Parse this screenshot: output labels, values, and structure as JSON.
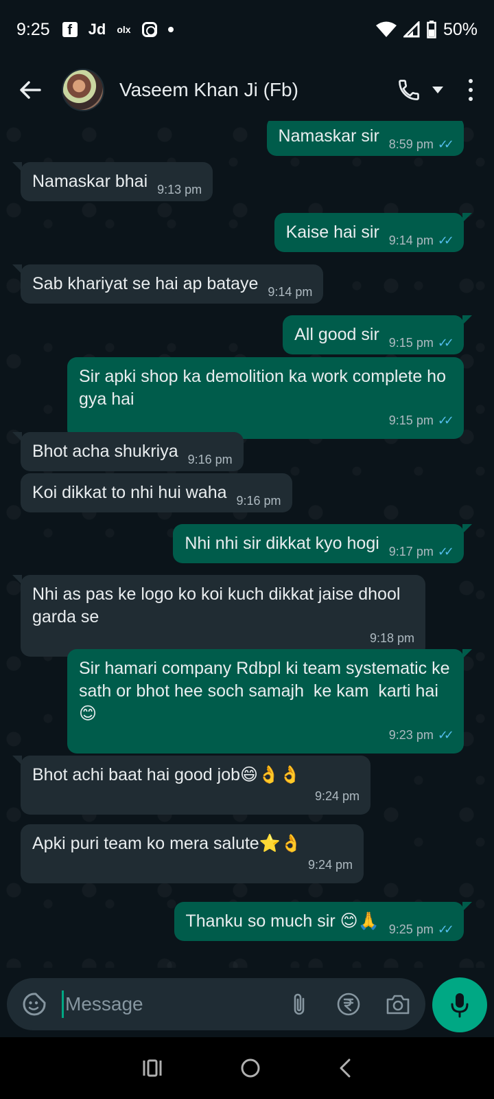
{
  "status_bar": {
    "time": "9:25",
    "app_icons": [
      "facebook-icon",
      "jd-icon",
      "olx-icon",
      "instagram-icon",
      "dot"
    ],
    "jd_label": "Jd",
    "olx_label": "olx",
    "battery": "50%"
  },
  "header": {
    "contact_name": "Vaseem Khan Ji (Fb)"
  },
  "messages": [
    {
      "dir": "out",
      "text": "Namaskar sir",
      "time": "8:59 pm",
      "read": true
    },
    {
      "dir": "in",
      "text": "Namaskar bhai",
      "time": "9:13 pm"
    },
    {
      "dir": "out",
      "text": "Kaise hai sir",
      "time": "9:14 pm",
      "read": true
    },
    {
      "dir": "in",
      "text": "Sab khariyat se hai ap bataye",
      "time": "9:14 pm"
    },
    {
      "dir": "out",
      "text": "All good sir",
      "time": "9:15 pm",
      "read": true
    },
    {
      "dir": "out",
      "text": "Sir apki shop ka demolition ka work complete ho gya hai",
      "time": "9:15 pm",
      "read": true
    },
    {
      "dir": "in",
      "text": "Bhot acha shukriya",
      "time": "9:16 pm"
    },
    {
      "dir": "in",
      "text": "Koi dikkat to nhi hui waha",
      "time": "9:16 pm"
    },
    {
      "dir": "out",
      "text": "Nhi nhi sir dikkat kyo hogi",
      "time": "9:17 pm",
      "read": true
    },
    {
      "dir": "in",
      "text": "Nhi as pas ke logo ko koi kuch dikkat jaise dhool garda se",
      "time": "9:18 pm"
    },
    {
      "dir": "out",
      "text": "Sir hamari company Rdbpl ki team systematic ke sath or bhot hee soch samajh  ke kam  karti hai 😊",
      "time": "9:23 pm",
      "read": true
    },
    {
      "dir": "in",
      "text": "Bhot achi baat hai good job😄👌👌",
      "time": "9:24 pm"
    },
    {
      "dir": "in",
      "text": "Apki puri team ko mera salute⭐👌",
      "time": "9:24 pm"
    },
    {
      "dir": "out",
      "text": "Thanku so much sir 😊🙏",
      "time": "9:25 pm",
      "read": true
    }
  ],
  "composer": {
    "placeholder": "Message"
  },
  "colors": {
    "background": "#0b141a",
    "incoming_bubble": "#202c33",
    "outgoing_bubble": "#005c4b",
    "accent": "#00a884",
    "read_ticks": "#53bdeb"
  }
}
